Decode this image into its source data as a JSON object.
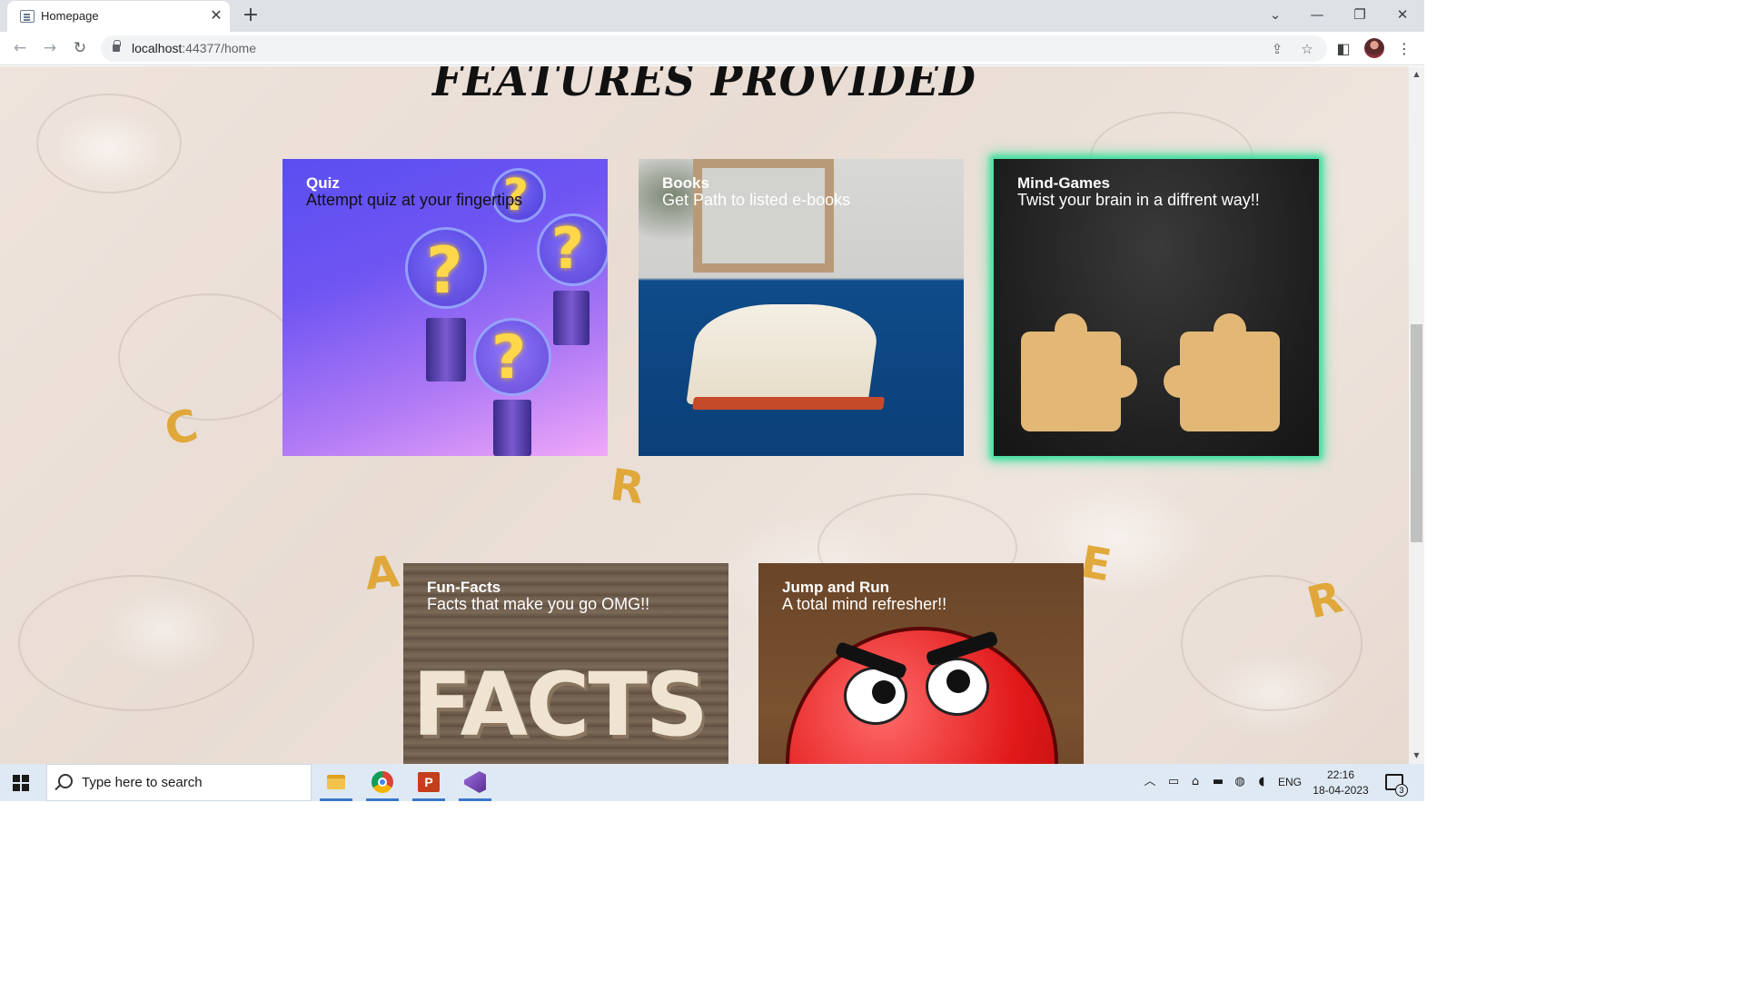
{
  "browser": {
    "tab_title": "Homepage",
    "tab_close": "✕",
    "new_tab": "+",
    "url_host": "localhost",
    "url_rest": ":44377/home",
    "window_controls": {
      "dropdown": "⌄",
      "minimize": "—",
      "restore": "❐",
      "close": "✕"
    }
  },
  "page": {
    "heading": "FEATURES PROVIDED",
    "cards": [
      {
        "title": "Quiz",
        "description": "Attempt quiz at your fingertips"
      },
      {
        "title": "Books",
        "description": "Get Path to listed e-books"
      },
      {
        "title": "Mind-Games",
        "description": "Twist your brain in a diffrent way!!"
      },
      {
        "title": "Fun-Facts",
        "description": "Facts that make you go OMG!!",
        "image_text": "FACTS"
      },
      {
        "title": "Jump and Run",
        "description": "A total mind refresher!!"
      }
    ],
    "background_letters": [
      "C",
      "R",
      "A",
      "E",
      "R"
    ],
    "accent_glow": "#40e0a0"
  },
  "taskbar": {
    "search_placeholder": "Type here to search",
    "language": "ENG",
    "time": "22:16",
    "date": "18-04-2023",
    "notification_count": "3"
  }
}
